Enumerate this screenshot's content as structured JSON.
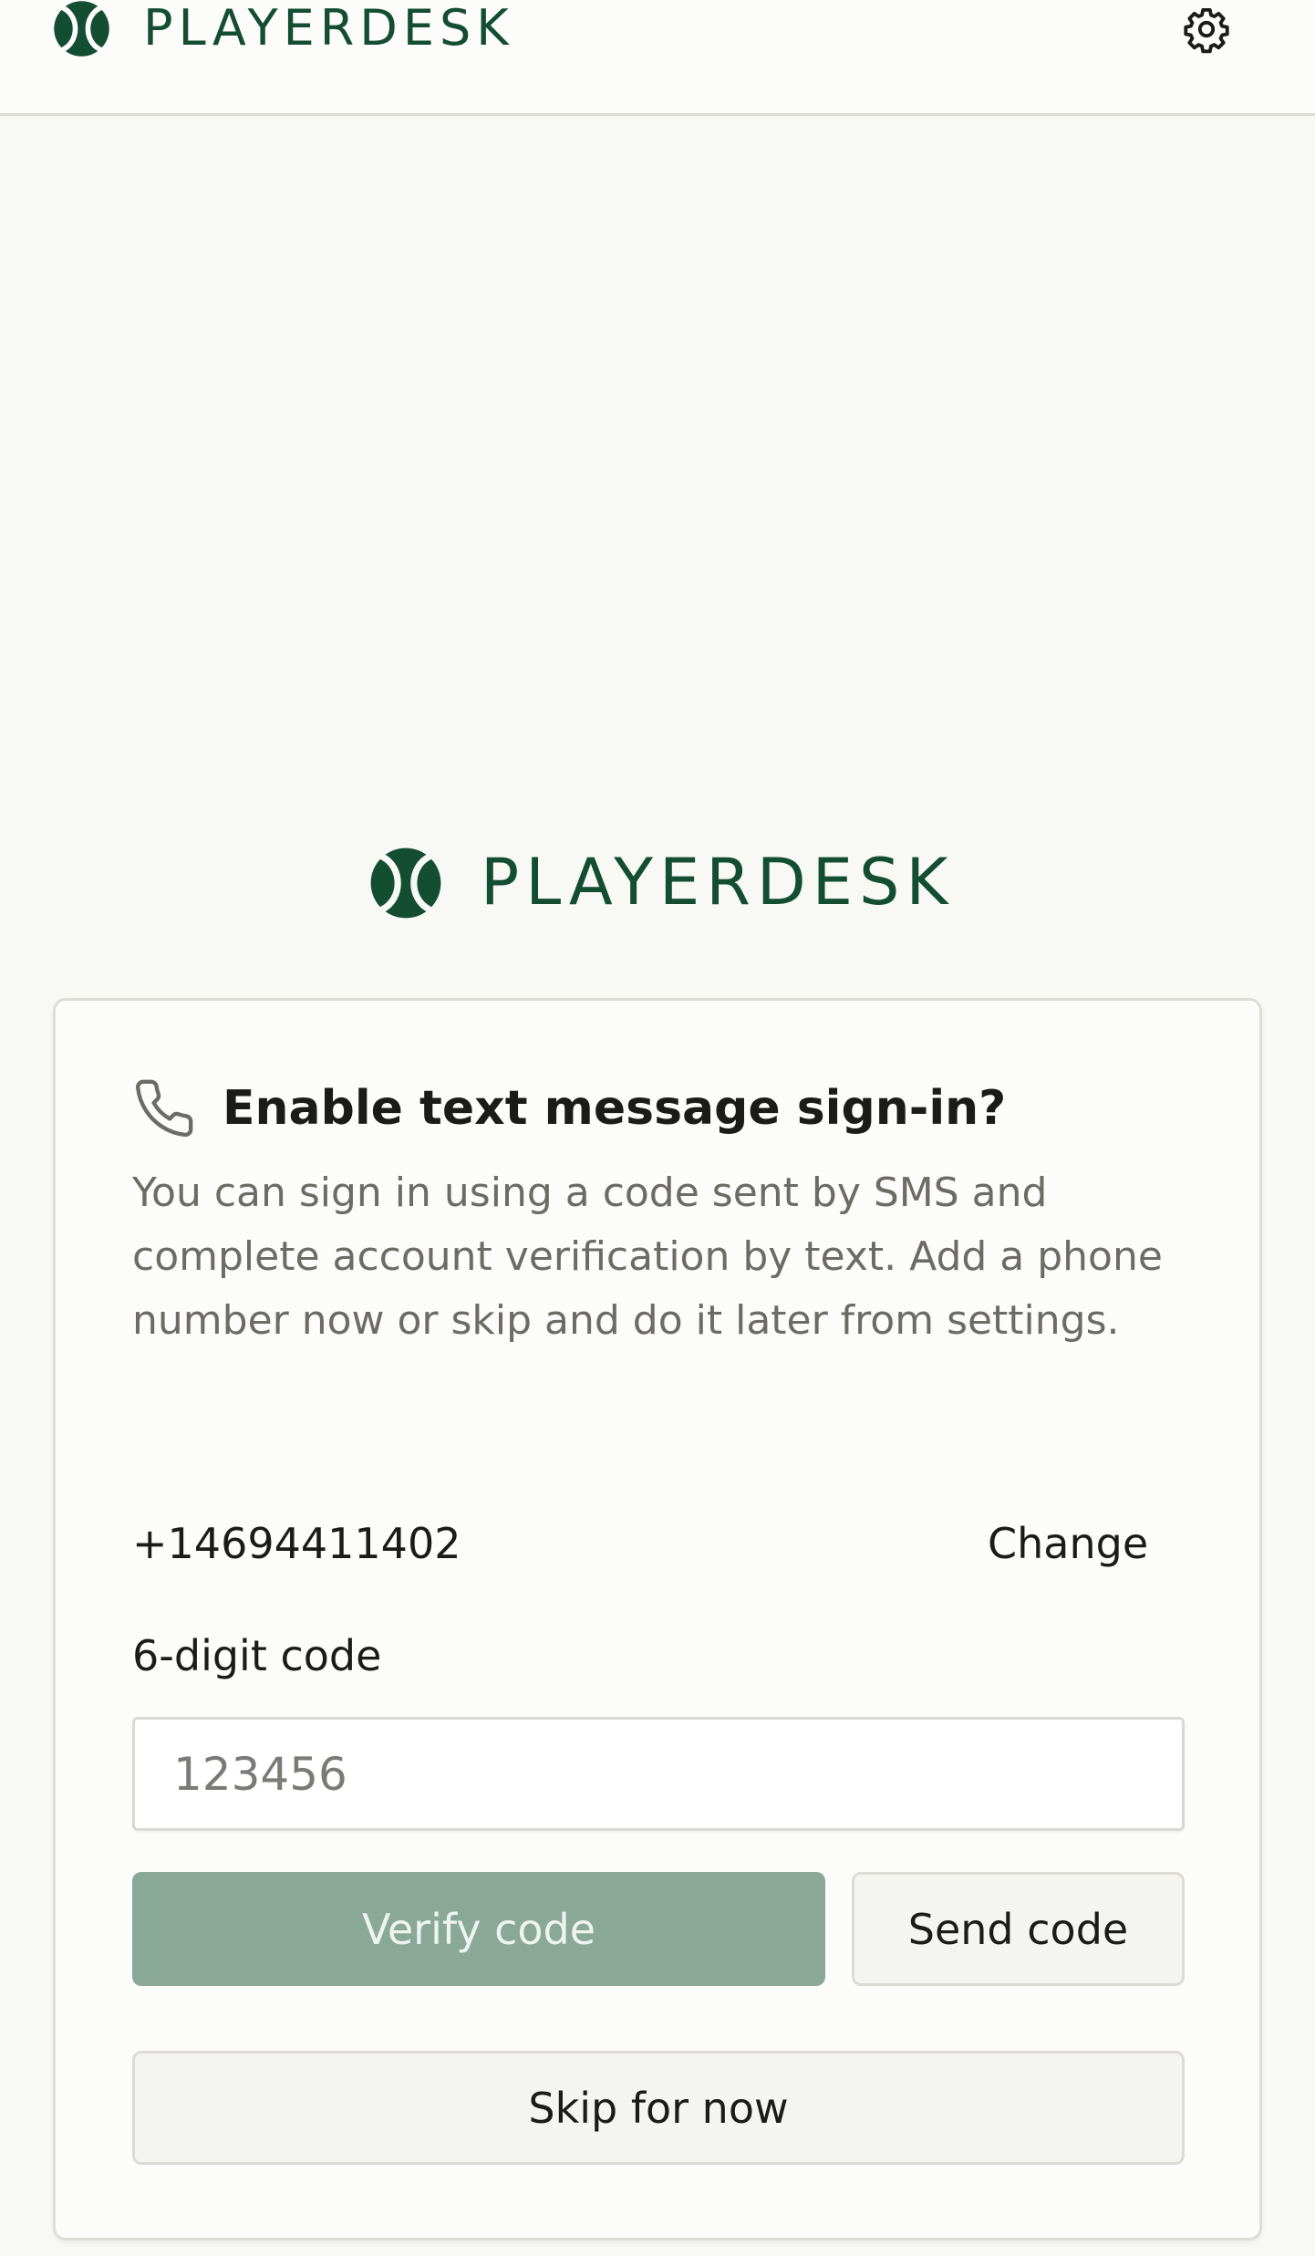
{
  "header": {
    "brand_name": "PLAYERDESK",
    "settings_icon": "gear-icon"
  },
  "hero": {
    "brand_name": "PLAYERDESK"
  },
  "card": {
    "icon": "phone-icon",
    "title": "Enable text message sign-in?",
    "description": "You can sign in using a code sent by SMS and complete account verification by text. Add a phone number now or skip and do it later from settings.",
    "phone_number": "+14694411402",
    "change_label": "Change",
    "code_label": "6-digit code",
    "code_value": "",
    "code_placeholder": "123456",
    "verify_label": "Verify code",
    "send_label": "Send code",
    "skip_label": "Skip for now"
  },
  "colors": {
    "brand": "#134d32",
    "primary_disabled": "#89a898",
    "background": "#f8f8f5"
  }
}
